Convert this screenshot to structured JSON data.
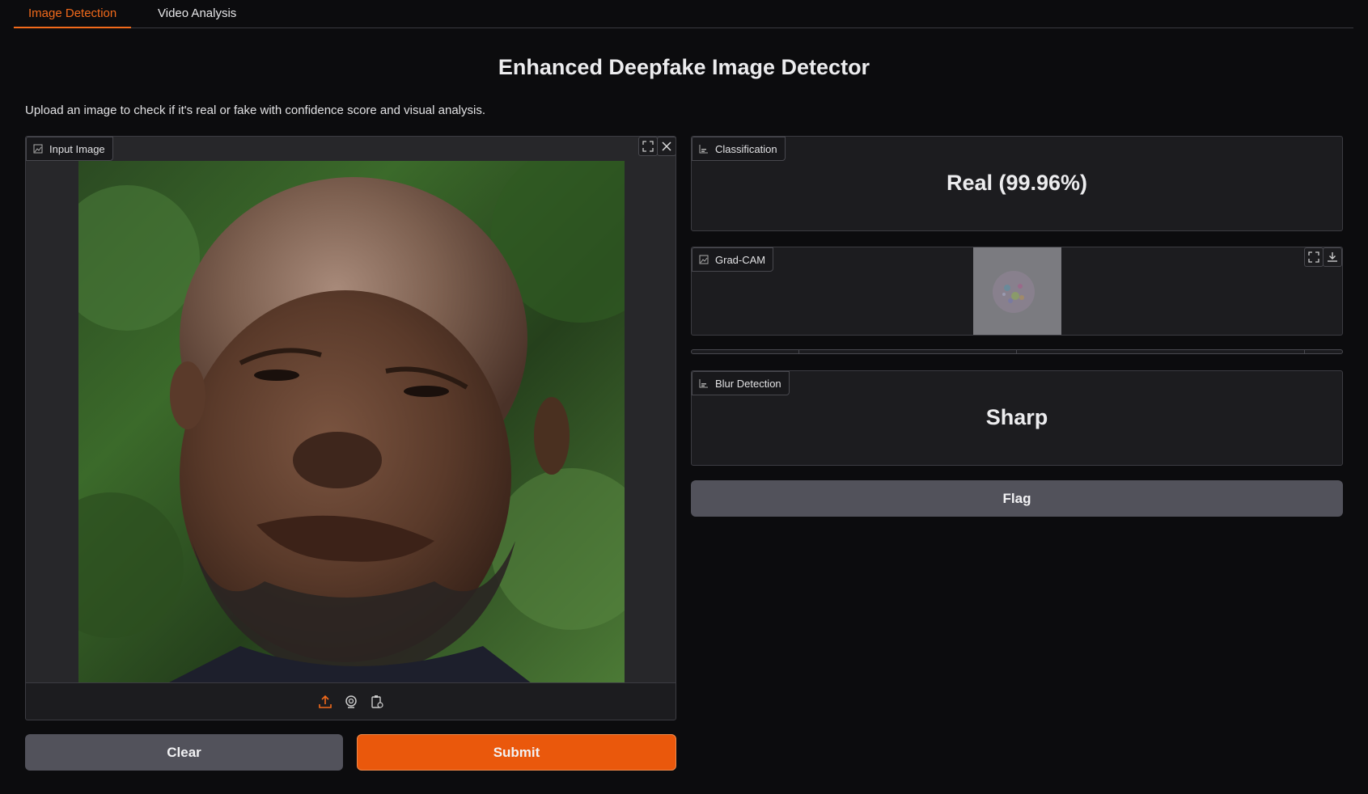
{
  "tabs": [
    {
      "label": "Image Detection",
      "active": true
    },
    {
      "label": "Video Analysis",
      "active": false
    }
  ],
  "page": {
    "title": "Enhanced Deepfake Image Detector",
    "description": "Upload an image to check if it's real or fake with confidence score and visual analysis."
  },
  "input_image": {
    "label": "Input Image",
    "icons": [
      "image-icon",
      "fullscreen-icon",
      "close-icon",
      "upload-icon",
      "webcam-icon",
      "clipboard-icon"
    ]
  },
  "buttons": {
    "clear": "Clear",
    "submit": "Submit",
    "flag": "Flag"
  },
  "classification": {
    "label": "Classification",
    "value": "Real (99.96%)"
  },
  "gradcam": {
    "label": "Grad-CAM",
    "icons": [
      "fullscreen-icon",
      "download-icon"
    ]
  },
  "blur_detection": {
    "label": "Blur Detection",
    "value": "Sharp"
  },
  "colors": {
    "accent": "#f26a1b",
    "submit_bg": "#ea580c",
    "secondary_bg": "#52525b",
    "page_bg": "#0c0c0e"
  }
}
